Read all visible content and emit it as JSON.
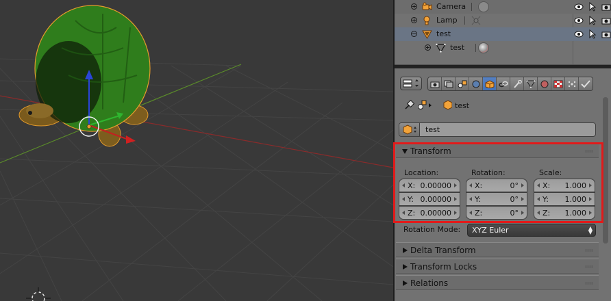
{
  "outliner": {
    "rows": [
      {
        "label": "Camera",
        "icon": "camera-icon"
      },
      {
        "label": "Lamp",
        "icon": "lamp-icon"
      },
      {
        "label": "test",
        "icon": "mesh-object-icon"
      },
      {
        "label": "test",
        "icon": "mesh-data-icon"
      }
    ]
  },
  "properties": {
    "breadcrumb": "test",
    "object_name": "test",
    "transform_panel": {
      "title": "Transform",
      "location_label": "Location:",
      "rotation_label": "Rotation:",
      "scale_label": "Scale:",
      "location": [
        {
          "axis": "X:",
          "value": "0.00000"
        },
        {
          "axis": "Y:",
          "value": "0.00000"
        },
        {
          "axis": "Z:",
          "value": "0.00000"
        }
      ],
      "rotation": [
        {
          "axis": "X:",
          "value": "0°"
        },
        {
          "axis": "Y:",
          "value": "0°"
        },
        {
          "axis": "Z:",
          "value": "0°"
        }
      ],
      "scale": [
        {
          "axis": "X:",
          "value": "1.000"
        },
        {
          "axis": "Y:",
          "value": "1.000"
        },
        {
          "axis": "Z:",
          "value": "1.000"
        }
      ],
      "rotation_mode_label": "Rotation Mode:",
      "rotation_mode_value": "XYZ Euler"
    },
    "collapsed_panels": [
      "Delta Transform",
      "Transform Locks",
      "Relations"
    ]
  },
  "colors": {
    "highlight": "#e21a1a",
    "active_tab": "#4f7cc0",
    "selected_row": "#6a7585"
  }
}
